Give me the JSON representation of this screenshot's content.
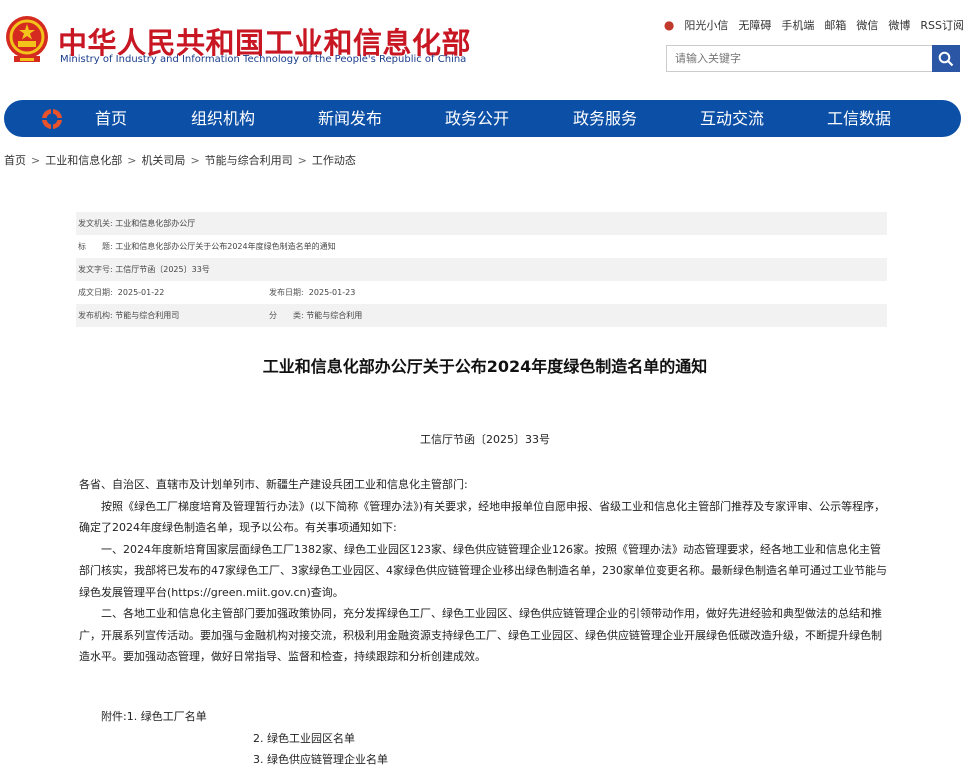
{
  "header": {
    "logo_cn": "中华人民共和国工业和信息化部",
    "logo_en": "Ministry of Industry and Information Technology of the People's Republic of China",
    "toplinks": [
      "阳光小信",
      "无障碍",
      "手机端",
      "邮箱",
      "微信",
      "微博",
      "RSS订阅"
    ],
    "search_placeholder": "请输入关键字"
  },
  "nav": {
    "items": [
      "首页",
      "组织机构",
      "新闻发布",
      "政务公开",
      "政务服务",
      "互动交流",
      "工信数据"
    ]
  },
  "breadcrumb": [
    "首页",
    "工业和信息化部",
    "机关司局",
    "节能与综合利用司",
    "工作动态"
  ],
  "info": {
    "issuer_label": "发文机关:",
    "issuer": "工业和信息化部办公厅",
    "title_label": "标　　题:",
    "title": "工业和信息化部办公厅关于公布2024年度绿色制造名单的通知",
    "docno_label": "发文字号:",
    "docno": "工信厅节函〔2025〕33号",
    "written_label": "成文日期:",
    "written": "2025-01-22",
    "published_label": "发布日期:",
    "published": "2025-01-23",
    "org_label": "发布机构:",
    "org": "节能与综合利用司",
    "category_label": "分　　类:",
    "category": "节能与综合利用"
  },
  "document": {
    "title": "工业和信息化部办公厅关于公布2024年度绿色制造名单的通知",
    "number": "工信厅节函〔2025〕33号",
    "salutation": "各省、自治区、直辖市及计划单列市、新疆生产建设兵团工业和信息化主管部门:",
    "para1": "按照《绿色工厂梯度培育及管理暂行办法》(以下简称《管理办法》)有关要求，经地申报单位自愿申报、省级工业和信息化主管部门推荐及专家评审、公示等程序，确定了2024年度绿色制造名单，现予以公布。有关事项通知如下:",
    "para2": "一、2024年度新培育国家层面绿色工厂1382家、绿色工业园区123家、绿色供应链管理企业126家。按照《管理办法》动态管理要求，经各地工业和信息化主管部门核实，我部将已发布的47家绿色工厂、3家绿色工业园区、4家绿色供应链管理企业移出绿色制造名单，230家单位变更名称。最新绿色制造名单可通过工业节能与绿色发展管理平台(https://green.miit.gov.cn)查询。",
    "para3": "二、各地工业和信息化主管部门要加强政策协同，充分发挥绿色工厂、绿色工业园区、绿色供应链管理企业的引领带动作用，做好先进经验和典型做法的总结和推广，开展系列宣传活动。要加强与金融机构对接交流，积极利用金融资源支持绿色工厂、绿色工业园区、绿色供应链管理企业开展绿色低碳改造升级，不断提升绿色制造水平。要加强动态管理，做好日常指导、监督和检查，持续跟踪和分析创建成效。",
    "attachments": [
      "附件:1. 绿色工厂名单",
      "2. 绿色工业园区名单",
      "3. 绿色供应链管理企业名单"
    ]
  }
}
